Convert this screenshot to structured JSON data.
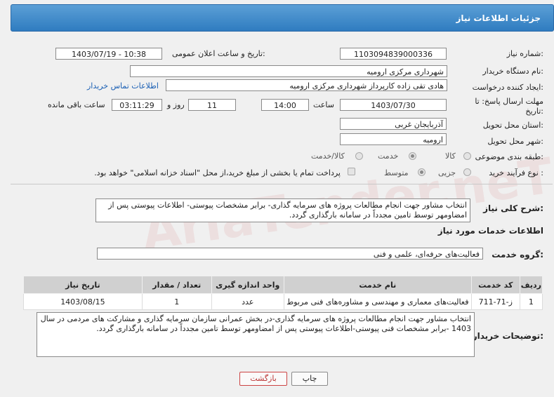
{
  "header": {
    "title": "جزئیات اطلاعات نیاز"
  },
  "form": {
    "need_number_label": "شماره نیاز:",
    "need_number": "1103094839000336",
    "announce_label": "تاریخ و ساعت اعلان عمومی:",
    "announce_value": "1403/07/19 - 10:38",
    "buyer_org_label": "نام دستگاه خریدار:",
    "buyer_org": "شهرداری مرکزی ارومیه",
    "creator_label": "ایجاد کننده درخواست:",
    "creator": "هادی تقی زاده کارپرداز شهرداری مرکزی ارومیه",
    "contact_link": "اطلاعات تماس خریدار",
    "deadline_label": "مهلت ارسال پاسخ: تا تاریخ:",
    "deadline_date": "1403/07/30",
    "hour_label": "ساعت",
    "deadline_time": "14:00",
    "days_value": "11",
    "days_label": "روز و",
    "remaining_time": "03:11:29",
    "remaining_label": "ساعت باقی مانده",
    "province_label": "استان محل تحویل:",
    "province": "آذربایجان غربی",
    "city_label": "شهر محل تحویل:",
    "city": "ارومیه",
    "category_label": "طبقه بندی موضوعی:",
    "category_options": [
      "کالا",
      "خدمت",
      "کالا/خدمت"
    ],
    "category_selected": "خدمت",
    "process_label": "نوع فرآیند خرید :",
    "process_options": [
      "جزیی",
      "متوسط"
    ],
    "process_selected": "متوسط",
    "payment_note": "پرداخت تمام یا بخشی از مبلغ خرید،از محل \"اسناد خزانه اسلامی\" خواهد بود."
  },
  "description": {
    "label": "شرح کلی نیاز:",
    "text": "انتخاب مشاور جهت  انجام مطالعات پروژه های سرمایه گذاری- برابر مشخصات پیوستی- اطلاعات پیوستی پس از امضاومهر توسط تامین مجدداً در سامانه بارگذاری گردد."
  },
  "services": {
    "section_title": "اطلاعات خدمات مورد نیاز",
    "group_label": "گروه خدمت:",
    "group_value": "فعالیت‌های حرفه‌ای، علمی و فنی",
    "columns": [
      "ردیف",
      "کد خدمت",
      "نام خدمت",
      "واحد اندازه گیری",
      "تعداد / مقدار",
      "تاریخ نیاز"
    ],
    "rows": [
      {
        "row": "1",
        "code": "ز-71-711",
        "name": "فعالیت‌های معماری و مهندسی و مشاوره‌های فنی مربوط",
        "unit": "عدد",
        "qty": "1",
        "date": "1403/08/15"
      }
    ]
  },
  "buyer_notes": {
    "label": "توضیحات خریدار:",
    "text": "انتخاب مشاور جهت  انجام مطالعات پروژه های سرمایه گذاری-در بخش عمرانی سازمان سرمایه گذاری و مشارکت های مردمی در سال 1403 -برابر مشخصات فنی پیوستی-اطلاعات پیوستی پس از امضاومهر توسط تامین مجدداً در سامانه بارگذاری گردد."
  },
  "buttons": {
    "print": "چاپ",
    "back": "بازگشت"
  },
  "watermark": "AriaTender.neT",
  "colors": {
    "header_bg": "#2f7cc0",
    "link": "#1a5fb4",
    "back_button": "#b33333"
  }
}
